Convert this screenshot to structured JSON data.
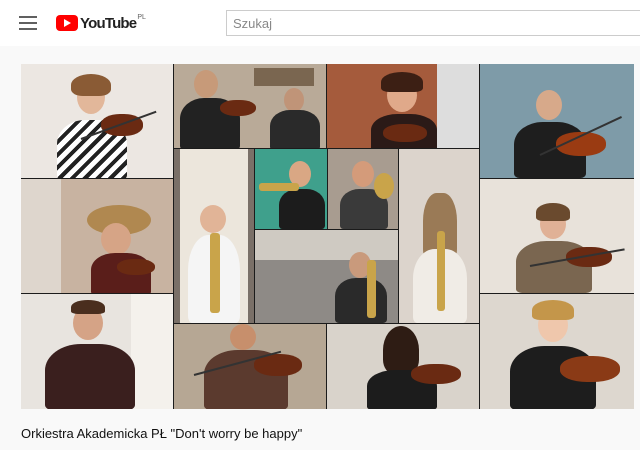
{
  "header": {
    "logo_text": "YouTube",
    "logo_country": "PL",
    "search_placeholder": "Szukaj",
    "menu_icon": "hamburger-menu-icon",
    "logo_icon": "youtube-play-icon",
    "brand_color": "#ff0000"
  },
  "video": {
    "title": "Orkiestra Akademicka PŁ \"Don't worry be happy\"",
    "thumbnail_content": "video-call-orchestra-grid"
  }
}
